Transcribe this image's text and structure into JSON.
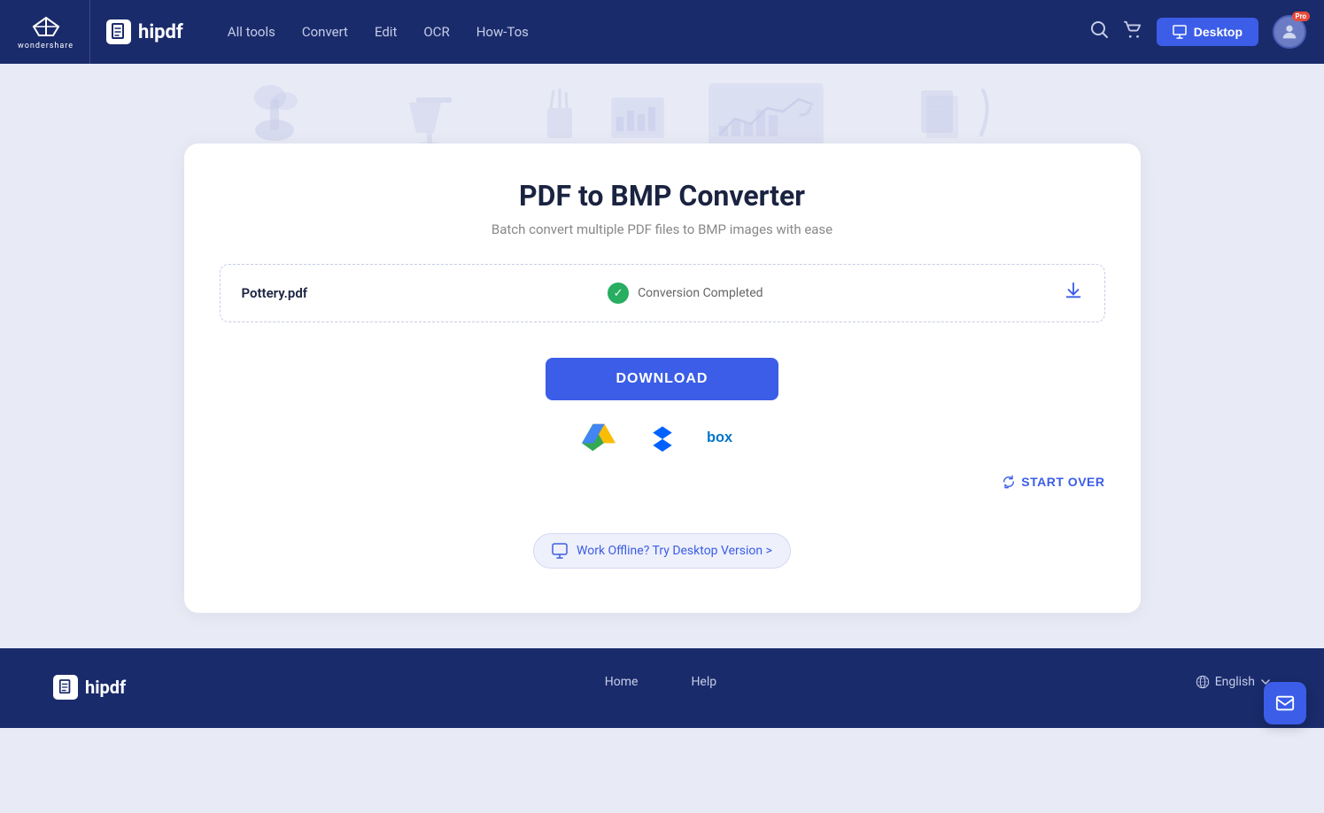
{
  "brand": {
    "wondershare_label": "wondershare",
    "hipdf_label": "hipdf"
  },
  "navbar": {
    "all_tools": "All tools",
    "convert": "Convert",
    "edit": "Edit",
    "ocr": "OCR",
    "how_tos": "How-Tos",
    "desktop_btn": "Desktop",
    "pro_badge": "Pro"
  },
  "page": {
    "title": "PDF to BMP Converter",
    "subtitle": "Batch convert multiple PDF files to BMP images with ease"
  },
  "file": {
    "name": "Pottery.pdf",
    "status": "Conversion Completed"
  },
  "actions": {
    "download_btn": "DOWNLOAD",
    "start_over": "START OVER",
    "desktop_promo": "Work Offline? Try Desktop Version >"
  },
  "cloud": {
    "gdrive_label": "Google Drive",
    "dropbox_label": "Dropbox",
    "box_label": "Box"
  },
  "footer": {
    "home": "Home",
    "help": "Help",
    "language": "English"
  },
  "colors": {
    "brand_blue": "#1a2b6b",
    "accent_blue": "#3b5de7",
    "green_check": "#27ae60"
  }
}
